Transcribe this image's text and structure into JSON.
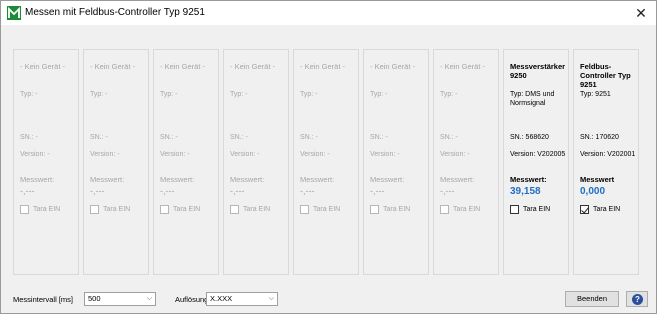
{
  "window": {
    "title": "Messen mit Feldbus-Controller Typ 9251",
    "close_glyph": "✕"
  },
  "cards": [
    {
      "name": "- Kein Gerät -",
      "type": "Typ: -",
      "sn": "SN.: -",
      "version": "Version: -",
      "measure_label": "Messwert:",
      "measure_value": "-,---",
      "tara_label": "Tara EIN",
      "tara_checked": false,
      "active": false
    },
    {
      "name": "- Kein Gerät -",
      "type": "Typ: -",
      "sn": "SN.: -",
      "version": "Version: -",
      "measure_label": "Messwert:",
      "measure_value": "-,---",
      "tara_label": "Tara EIN",
      "tara_checked": false,
      "active": false
    },
    {
      "name": "- Kein Gerät -",
      "type": "Typ: -",
      "sn": "SN.: -",
      "version": "Version: -",
      "measure_label": "Messwert:",
      "measure_value": "-,---",
      "tara_label": "Tara EIN",
      "tara_checked": false,
      "active": false
    },
    {
      "name": "- Kein Gerät -",
      "type": "Typ: -",
      "sn": "SN.: -",
      "version": "Version: -",
      "measure_label": "Messwert:",
      "measure_value": "-,---",
      "tara_label": "Tara EIN",
      "tara_checked": false,
      "active": false
    },
    {
      "name": "- Kein Gerät -",
      "type": "Typ: -",
      "sn": "SN.: -",
      "version": "Version: -",
      "measure_label": "Messwert:",
      "measure_value": "-,---",
      "tara_label": "Tara EIN",
      "tara_checked": false,
      "active": false
    },
    {
      "name": "- Kein Gerät -",
      "type": "Typ: -",
      "sn": "SN.: -",
      "version": "Version: -",
      "measure_label": "Messwert:",
      "measure_value": "-,---",
      "tara_label": "Tara EIN",
      "tara_checked": false,
      "active": false
    },
    {
      "name": "- Kein Gerät -",
      "type": "Typ: -",
      "sn": "SN.: -",
      "version": "Version: -",
      "measure_label": "Messwert:",
      "measure_value": "-,---",
      "tara_label": "Tara EIN",
      "tara_checked": false,
      "active": false
    },
    {
      "name": "Messverstärker 9250",
      "type": "Typ: DMS und Normsignal",
      "sn": "SN.: 568620",
      "version": "Version: V202005",
      "measure_label": "Messwert:",
      "measure_value": "39,158",
      "tara_label": "Tara EIN",
      "tara_checked": false,
      "active": true
    },
    {
      "name": "Feldbus-Controller Typ 9251",
      "type": "Typ: 9251",
      "sn": "SN.: 170620",
      "version": "Version: V202001",
      "measure_label": "Messwert",
      "measure_value": "0,000",
      "tara_label": "Tara EIN",
      "tara_checked": true,
      "active": true
    }
  ],
  "bottom": {
    "interval_label": "Messintervall [ms]",
    "interval_value": "500",
    "resolution_label": "Auflösung",
    "resolution_value": "X.XXX",
    "close_button": "Beenden",
    "help_glyph": "?"
  },
  "colors": {
    "accent_value": "#1f6fc3",
    "app_icon": "#1e8a3c"
  }
}
